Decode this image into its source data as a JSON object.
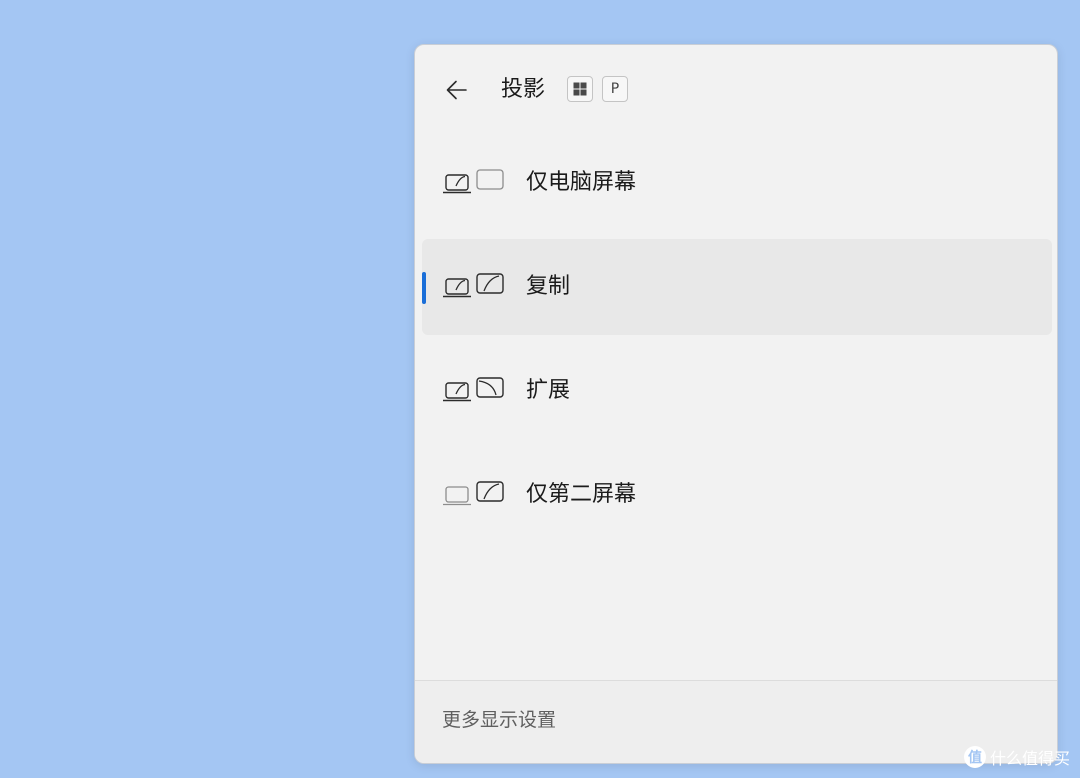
{
  "panel": {
    "title": "投影",
    "shortcut_keys": [
      {
        "icon": "windows-key-icon"
      },
      {
        "label": "P"
      }
    ]
  },
  "options": [
    {
      "label": "仅电脑屏幕",
      "icon": "pc-screen-only-icon",
      "selected": false
    },
    {
      "label": "复制",
      "icon": "duplicate-icon",
      "selected": true
    },
    {
      "label": "扩展",
      "icon": "extend-icon",
      "selected": false
    },
    {
      "label": "仅第二屏幕",
      "icon": "second-screen-only-icon",
      "selected": false
    }
  ],
  "footer": {
    "link_label": "更多显示设置"
  },
  "watermark": {
    "badge": "值",
    "text": "什么值得买"
  },
  "colors": {
    "desktop_bg": "#a4c6f3",
    "panel_bg": "#f2f2f2",
    "accent": "#1a6ed8",
    "selected_bg": "#e8e8e8"
  }
}
